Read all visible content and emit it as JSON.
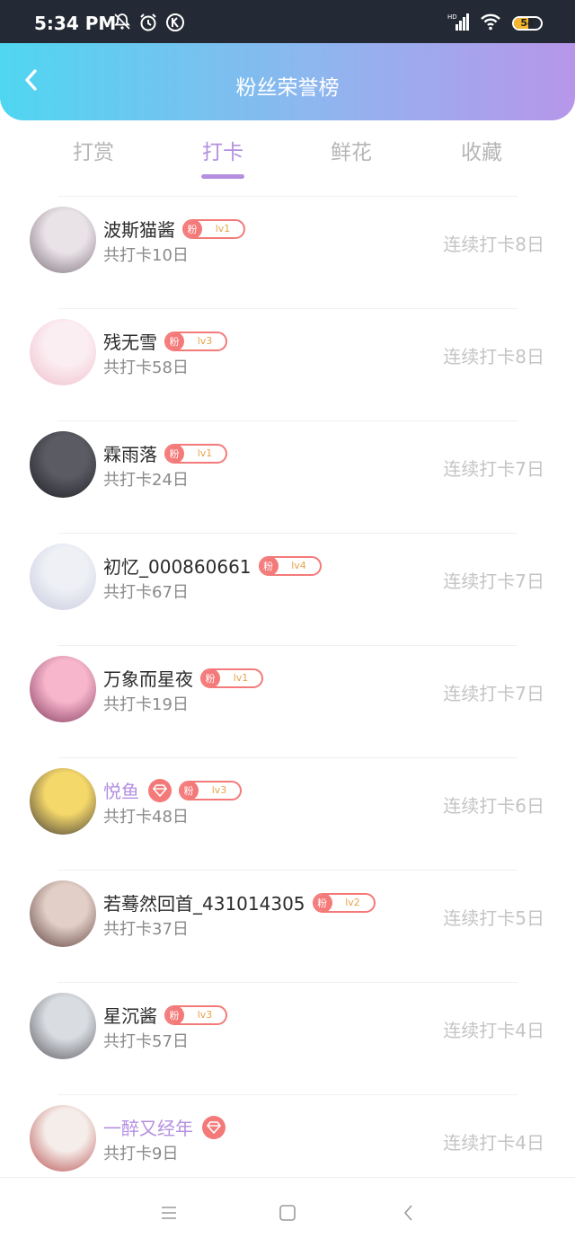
{
  "status": {
    "time": "5:34 PM",
    "battery": "54",
    "battery_level": 0.54,
    "network": "HD"
  },
  "header": {
    "title": "粉丝荣誉榜"
  },
  "tabs": [
    {
      "label": "打赏",
      "active": false
    },
    {
      "label": "打卡",
      "active": true
    },
    {
      "label": "鲜花",
      "active": false
    },
    {
      "label": "收藏",
      "active": false
    }
  ],
  "rows": [
    {
      "name": "波斯猫酱",
      "vip": false,
      "badge": "粉",
      "level": "lv1",
      "total": "共打卡10日",
      "streak": "连续打卡8日",
      "avatar_colors": [
        "#e9e3e8",
        "#7b6d76"
      ]
    },
    {
      "name": "残无雪",
      "vip": false,
      "badge": "粉",
      "level": "lv3",
      "total": "共打卡58日",
      "streak": "连续打卡8日",
      "avatar_colors": [
        "#fbeef2",
        "#f0bccb"
      ]
    },
    {
      "name": "霖雨落",
      "vip": false,
      "badge": "粉",
      "level": "lv1",
      "total": "共打卡24日",
      "streak": "连续打卡7日",
      "avatar_colors": [
        "#5b5b64",
        "#1c1c22"
      ]
    },
    {
      "name": "初忆_000860661",
      "vip": false,
      "badge": "粉",
      "level": "lv4",
      "total": "共打卡67日",
      "streak": "连续打卡7日",
      "avatar_colors": [
        "#eef0f6",
        "#c6c9dc"
      ]
    },
    {
      "name": "万象而星夜",
      "vip": false,
      "badge": "粉",
      "level": "lv1",
      "total": "共打卡19日",
      "streak": "连续打卡7日",
      "avatar_colors": [
        "#f7b6cc",
        "#7d3458"
      ]
    },
    {
      "name": "悦鱼",
      "vip": true,
      "badge": "粉",
      "level": "lv3",
      "total": "共打卡48日",
      "streak": "连续打卡6日",
      "avatar_colors": [
        "#f5d86a",
        "#3b3436"
      ]
    },
    {
      "name": "若蓦然回首_431014305",
      "vip": false,
      "badge": "粉",
      "level": "lv2",
      "total": "共打卡37日",
      "streak": "连续打卡5日",
      "avatar_colors": [
        "#e2cfc7",
        "#5a3b39"
      ]
    },
    {
      "name": "星沉酱",
      "vip": false,
      "badge": "粉",
      "level": "lv3",
      "total": "共打卡57日",
      "streak": "连续打卡4日",
      "avatar_colors": [
        "#d9dde2",
        "#55535a"
      ]
    },
    {
      "name": "一醉又经年",
      "vip": true,
      "badge": "",
      "level": "",
      "total": "共打卡9日",
      "streak": "连续打卡4日",
      "avatar_colors": [
        "#f5ede9",
        "#b54a4a"
      ]
    }
  ],
  "colors": {
    "accent": "#b48fe0",
    "badge": "#f47a7a",
    "level_text": "#e9a24a"
  }
}
